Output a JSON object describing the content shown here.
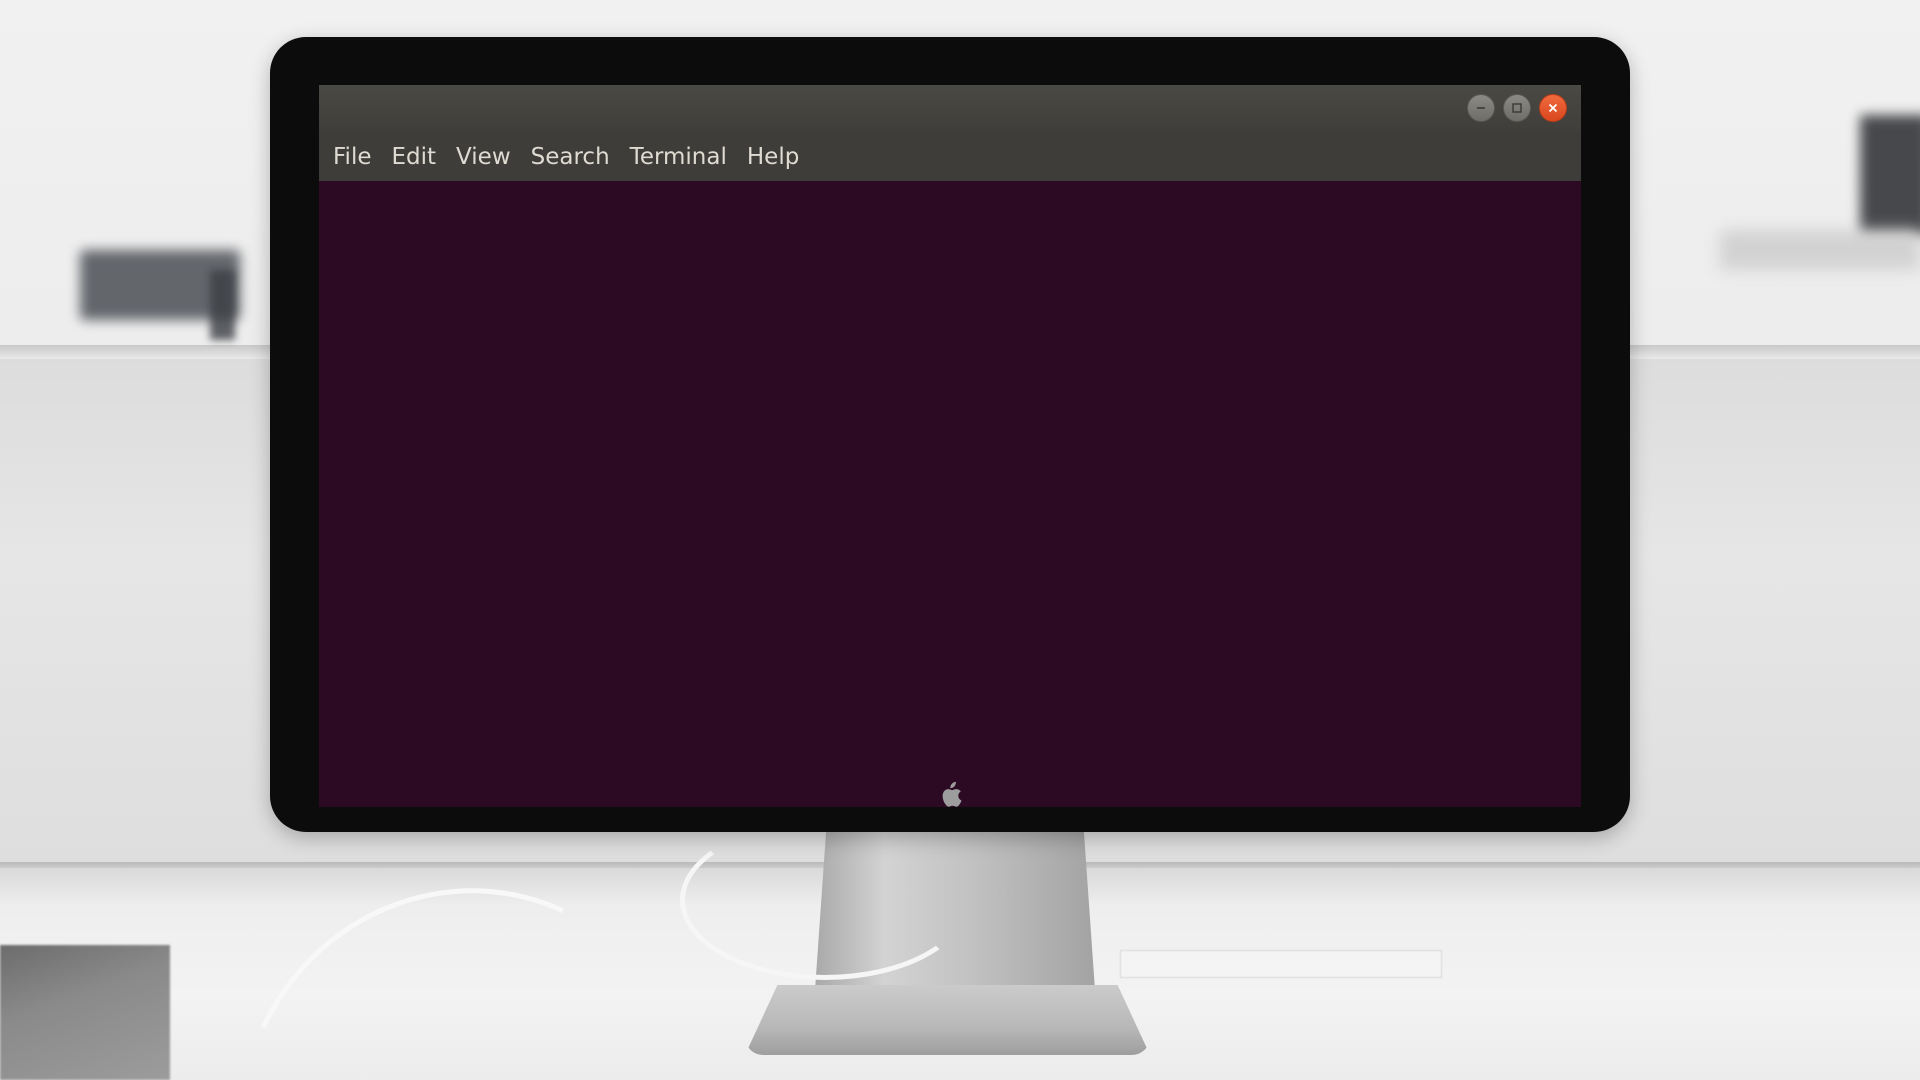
{
  "terminal": {
    "menu": [
      "File",
      "Edit",
      "View",
      "Search",
      "Terminal",
      "Help"
    ],
    "window_controls": {
      "minimize_icon": "minimize-icon",
      "maximize_icon": "maximize-icon",
      "close_icon": "close-icon"
    },
    "background_color": "#2c0a24",
    "titlebar_color": "#3f3e3a",
    "close_color": "#e8552b"
  },
  "monitor": {
    "logo_icon": "apple-logo-icon"
  }
}
